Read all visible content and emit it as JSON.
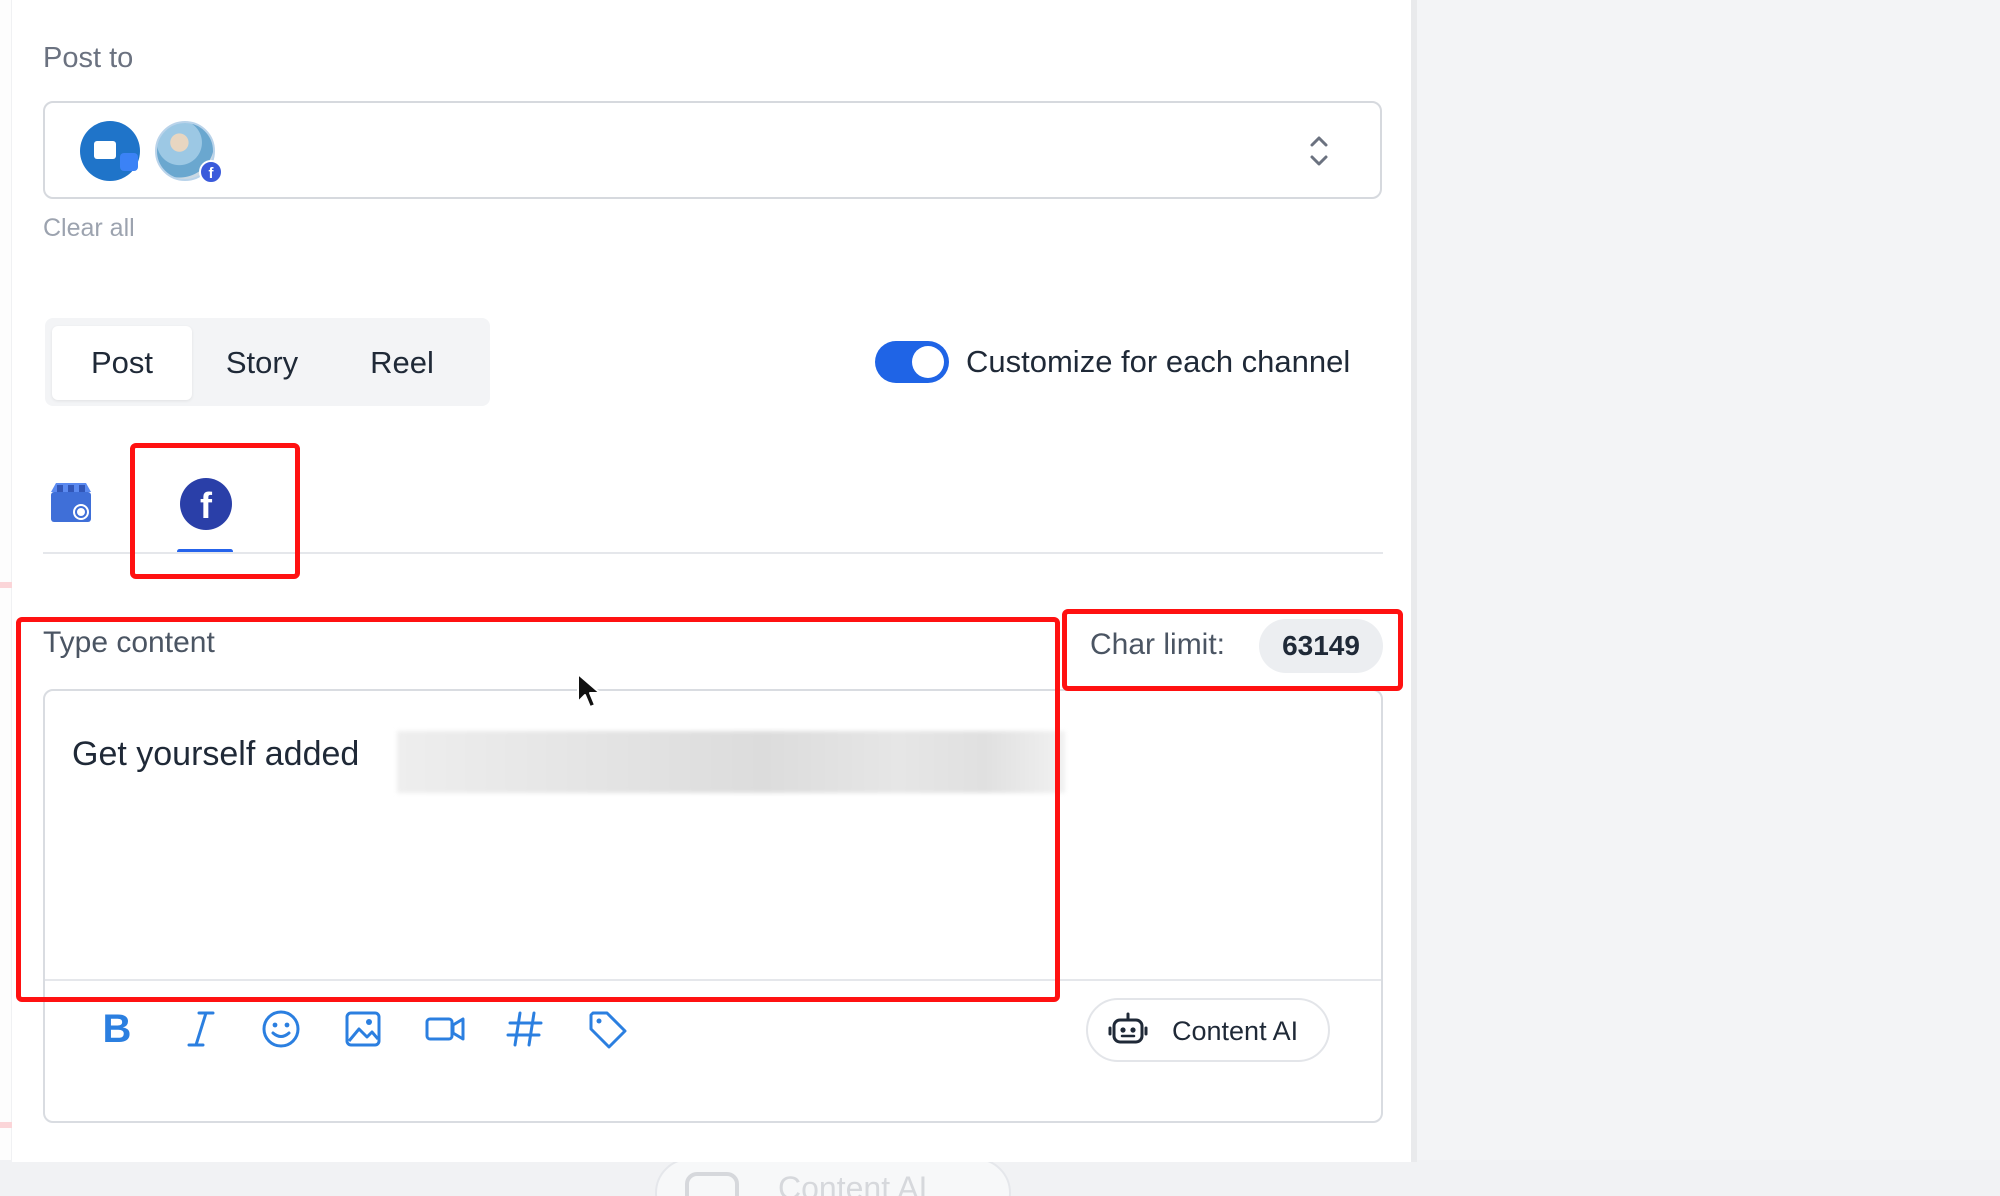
{
  "post_to": {
    "label": "Post to",
    "clear_all": "Clear all",
    "selected_channels": [
      {
        "name": "google-my-business",
        "icon": "storefront-icon"
      },
      {
        "name": "facebook-page",
        "icon": "facebook-icon"
      }
    ]
  },
  "post_types": {
    "tabs": [
      "Post",
      "Story",
      "Reel"
    ],
    "active": "Post"
  },
  "customize": {
    "label": "Customize for each channel",
    "enabled": true
  },
  "channel_tabs": {
    "active": "facebook",
    "fb_letter": "f"
  },
  "content": {
    "label": "Type content",
    "char_limit_label": "Char limit:",
    "char_limit_value": "63149",
    "text": "Get yourself added"
  },
  "toolbar": {
    "bold": "B",
    "items": [
      "bold-icon",
      "italic-icon",
      "emoji-icon",
      "image-icon",
      "video-icon",
      "hashtag-icon",
      "tag-icon"
    ],
    "content_ai_label": "Content AI"
  },
  "background": {
    "ghost_button_label": "Content AI"
  },
  "colors": {
    "accent": "#1f64e6",
    "toolbar_icon": "#2b7fe0",
    "facebook": "#2a3fa8",
    "highlight": "#ff1111"
  }
}
